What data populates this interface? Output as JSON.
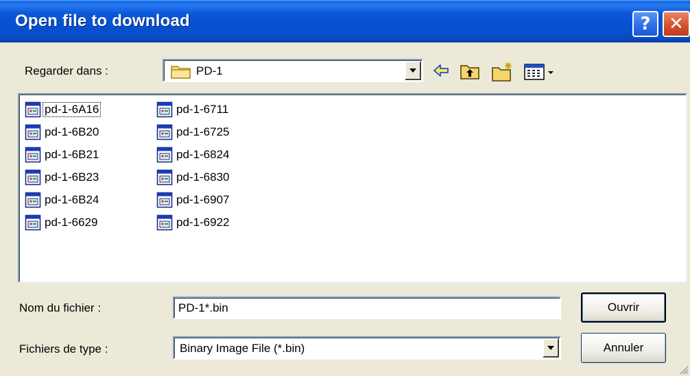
{
  "window": {
    "title": "Open file to download",
    "help_glyph": "?",
    "close_glyph": "✕"
  },
  "lookin": {
    "label": "Regarder dans :",
    "value": "PD-1",
    "folder_icon": "folder-icon"
  },
  "toolbar": {
    "back_icon": "back-arrow-icon",
    "up_icon": "up-folder-icon",
    "new_folder_icon": "new-folder-icon",
    "view_menu_icon": "view-menu-icon"
  },
  "files": {
    "column1": [
      "pd-1-6A16",
      "pd-1-6B20",
      "pd-1-6B21",
      "pd-1-6B23",
      "pd-1-6B24",
      "pd-1-6629"
    ],
    "column2": [
      "pd-1-6711",
      "pd-1-6725",
      "pd-1-6824",
      "pd-1-6830",
      "pd-1-6907",
      "pd-1-6922"
    ],
    "file_icon": "binary-file-icon",
    "focused": "pd-1-6A16"
  },
  "filename": {
    "label": "Nom du fichier :",
    "value": "PD-1*.bin"
  },
  "filetype": {
    "label": "Fichiers de type :",
    "value": "Binary Image File (*.bin)"
  },
  "buttons": {
    "open": "Ouvrir",
    "cancel": "Annuler"
  },
  "colors": {
    "titlebar": "#0552D1",
    "dialog_bg": "#ECE9D8",
    "close_button": "#D4532E"
  }
}
